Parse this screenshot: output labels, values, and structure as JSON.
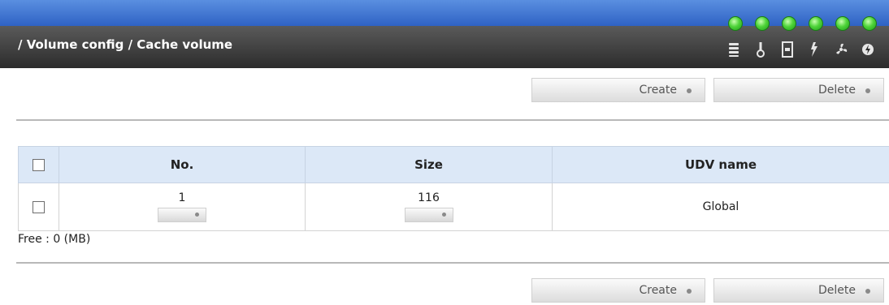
{
  "header": {
    "breadcrumb": "/ Volume config / Cache volume",
    "status_leds": [
      "green",
      "green",
      "green",
      "green",
      "green",
      "green"
    ],
    "status_icons": [
      "disk-icon",
      "temperature-icon",
      "power-supply-icon",
      "voltage-icon",
      "fan-icon",
      "power-icon"
    ]
  },
  "toolbar_top": {
    "create_label": "Create",
    "delete_label": "Delete"
  },
  "toolbar_bottom": {
    "create_label": "Create",
    "delete_label": "Delete"
  },
  "table": {
    "columns": [
      "No.",
      "Size",
      "UDV name"
    ],
    "rows": [
      {
        "no": "1",
        "size": "116",
        "udv_name": "Global"
      }
    ]
  },
  "free_text": "Free : 0 (MB)",
  "colors": {
    "accent_blue": "#3f73d6",
    "led_green": "#4fd43a",
    "header_bg": "#dce8f7"
  }
}
